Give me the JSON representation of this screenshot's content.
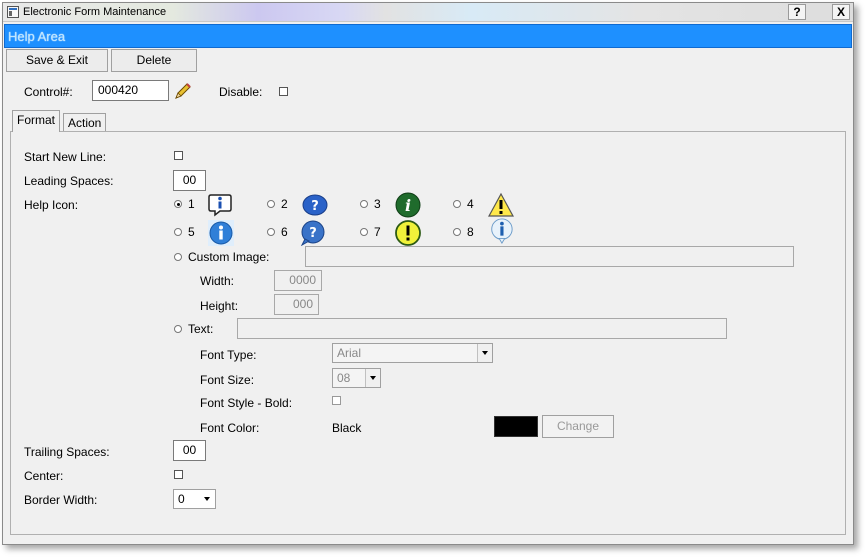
{
  "window": {
    "title": "Electronic Form Maintenance",
    "help_button": "?",
    "close_button": "X"
  },
  "help_bar": {
    "text": "Help Area"
  },
  "toolbar": {
    "save_exit": "Save & Exit",
    "delete": "Delete"
  },
  "header": {
    "control_label": "Control#:",
    "control_value": "000420",
    "disable_label": "Disable:"
  },
  "tabs": [
    {
      "label": "Format",
      "active": true
    },
    {
      "label": "Action",
      "active": false
    }
  ],
  "format": {
    "start_new_line_label": "Start New Line:",
    "leading_spaces_label": "Leading Spaces:",
    "leading_spaces_value": "00",
    "help_icon_label": "Help Icon:",
    "help_icons": [
      {
        "num": "1",
        "icon": "info-bubble-icon",
        "selected": true
      },
      {
        "num": "2",
        "icon": "blue-question-icon",
        "selected": false
      },
      {
        "num": "3",
        "icon": "green-info-icon",
        "selected": false
      },
      {
        "num": "4",
        "icon": "warning-triangle-icon",
        "selected": false
      },
      {
        "num": "5",
        "icon": "blue-info-icon",
        "selected": false
      },
      {
        "num": "6",
        "icon": "question-bubble-icon",
        "selected": false
      },
      {
        "num": "7",
        "icon": "exclamation-circle-icon",
        "selected": false
      },
      {
        "num": "8",
        "icon": "info-callout-icon",
        "selected": false
      }
    ],
    "custom_image_label": "Custom Image:",
    "width_label": "Width:",
    "width_value": "0000",
    "height_label": "Height:",
    "height_value": "000",
    "text_label": "Text:",
    "font_type_label": "Font Type:",
    "font_type_value": "Arial",
    "font_size_label": "Font Size:",
    "font_size_value": "08",
    "font_style_label": "Font Style - Bold:",
    "font_color_label": "Font Color:",
    "font_color_value": "Black",
    "font_color_swatch": "#000000",
    "change_button": "Change",
    "trailing_spaces_label": "Trailing Spaces:",
    "trailing_spaces_value": "00",
    "center_label": "Center:",
    "border_width_label": "Border Width:",
    "border_width_value": "0"
  },
  "colors": {
    "help_bar": "#1e90ff",
    "window_bg": "#f0f0f0"
  }
}
